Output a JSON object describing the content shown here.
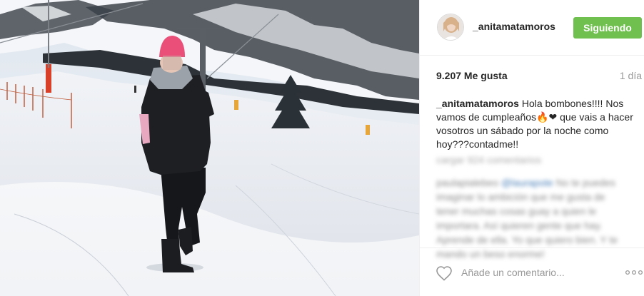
{
  "post": {
    "username": "_anitamatamoros",
    "follow_button_label": "Siguiendo",
    "likes": "9.207 Me gusta",
    "time_ago": "1 día",
    "caption": {
      "username": "_anitamatamoros",
      "text_before_emoji": " Hola bombones!!!! Nos vamos de cumpleaños",
      "emoji_fire": "🔥",
      "emoji_heart": "❤",
      "text_after_emoji": " que vais a hacer vosotros un sábado por la noche como hoy???contadme!!"
    },
    "blurred_comments": {
      "load_more": "cargar 924 comentarios",
      "comment_user": "paulapialebeo",
      "comment_mention": "@laurapote",
      "comment_text": " No te puedes imaginar lo ambición que me gusta de tener muchas cosas guay a quien le importara. Así quieren gente que hay. Aprende de ella. Yo que quiero bien. Y te mando un beso enorme!"
    },
    "comment_placeholder": "Añade un comentario...",
    "more_icon": "ellipsis-icon",
    "like_icon": "heart-outline-icon"
  }
}
